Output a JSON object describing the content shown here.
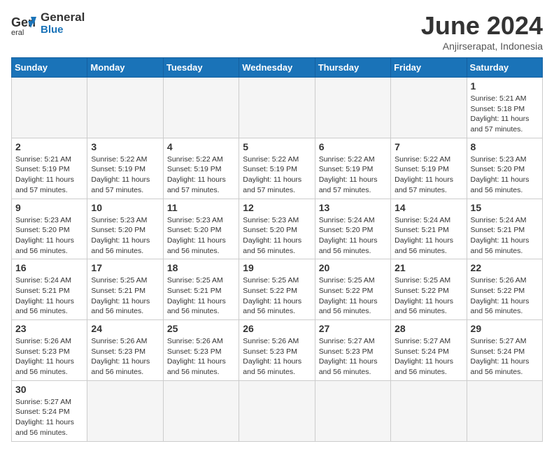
{
  "header": {
    "logo_line1": "General",
    "logo_line2": "Blue",
    "month_year": "June 2024",
    "location": "Anjirserapat, Indonesia"
  },
  "weekdays": [
    "Sunday",
    "Monday",
    "Tuesday",
    "Wednesday",
    "Thursday",
    "Friday",
    "Saturday"
  ],
  "weeks": [
    [
      {
        "day": null
      },
      {
        "day": null
      },
      {
        "day": null
      },
      {
        "day": null
      },
      {
        "day": null
      },
      {
        "day": null
      },
      {
        "day": "1",
        "sunrise": "5:21 AM",
        "sunset": "5:18 PM",
        "daylight": "11 hours and 57 minutes."
      }
    ],
    [
      {
        "day": "2",
        "sunrise": "5:21 AM",
        "sunset": "5:19 PM",
        "daylight": "11 hours and 57 minutes."
      },
      {
        "day": "3",
        "sunrise": "5:22 AM",
        "sunset": "5:19 PM",
        "daylight": "11 hours and 57 minutes."
      },
      {
        "day": "4",
        "sunrise": "5:22 AM",
        "sunset": "5:19 PM",
        "daylight": "11 hours and 57 minutes."
      },
      {
        "day": "5",
        "sunrise": "5:22 AM",
        "sunset": "5:19 PM",
        "daylight": "11 hours and 57 minutes."
      },
      {
        "day": "6",
        "sunrise": "5:22 AM",
        "sunset": "5:19 PM",
        "daylight": "11 hours and 57 minutes."
      },
      {
        "day": "7",
        "sunrise": "5:22 AM",
        "sunset": "5:19 PM",
        "daylight": "11 hours and 57 minutes."
      },
      {
        "day": "8",
        "sunrise": "5:23 AM",
        "sunset": "5:20 PM",
        "daylight": "11 hours and 56 minutes."
      }
    ],
    [
      {
        "day": "9",
        "sunrise": "5:23 AM",
        "sunset": "5:20 PM",
        "daylight": "11 hours and 56 minutes."
      },
      {
        "day": "10",
        "sunrise": "5:23 AM",
        "sunset": "5:20 PM",
        "daylight": "11 hours and 56 minutes."
      },
      {
        "day": "11",
        "sunrise": "5:23 AM",
        "sunset": "5:20 PM",
        "daylight": "11 hours and 56 minutes."
      },
      {
        "day": "12",
        "sunrise": "5:23 AM",
        "sunset": "5:20 PM",
        "daylight": "11 hours and 56 minutes."
      },
      {
        "day": "13",
        "sunrise": "5:24 AM",
        "sunset": "5:20 PM",
        "daylight": "11 hours and 56 minutes."
      },
      {
        "day": "14",
        "sunrise": "5:24 AM",
        "sunset": "5:21 PM",
        "daylight": "11 hours and 56 minutes."
      },
      {
        "day": "15",
        "sunrise": "5:24 AM",
        "sunset": "5:21 PM",
        "daylight": "11 hours and 56 minutes."
      }
    ],
    [
      {
        "day": "16",
        "sunrise": "5:24 AM",
        "sunset": "5:21 PM",
        "daylight": "11 hours and 56 minutes."
      },
      {
        "day": "17",
        "sunrise": "5:25 AM",
        "sunset": "5:21 PM",
        "daylight": "11 hours and 56 minutes."
      },
      {
        "day": "18",
        "sunrise": "5:25 AM",
        "sunset": "5:21 PM",
        "daylight": "11 hours and 56 minutes."
      },
      {
        "day": "19",
        "sunrise": "5:25 AM",
        "sunset": "5:22 PM",
        "daylight": "11 hours and 56 minutes."
      },
      {
        "day": "20",
        "sunrise": "5:25 AM",
        "sunset": "5:22 PM",
        "daylight": "11 hours and 56 minutes."
      },
      {
        "day": "21",
        "sunrise": "5:25 AM",
        "sunset": "5:22 PM",
        "daylight": "11 hours and 56 minutes."
      },
      {
        "day": "22",
        "sunrise": "5:26 AM",
        "sunset": "5:22 PM",
        "daylight": "11 hours and 56 minutes."
      }
    ],
    [
      {
        "day": "23",
        "sunrise": "5:26 AM",
        "sunset": "5:23 PM",
        "daylight": "11 hours and 56 minutes."
      },
      {
        "day": "24",
        "sunrise": "5:26 AM",
        "sunset": "5:23 PM",
        "daylight": "11 hours and 56 minutes."
      },
      {
        "day": "25",
        "sunrise": "5:26 AM",
        "sunset": "5:23 PM",
        "daylight": "11 hours and 56 minutes."
      },
      {
        "day": "26",
        "sunrise": "5:26 AM",
        "sunset": "5:23 PM",
        "daylight": "11 hours and 56 minutes."
      },
      {
        "day": "27",
        "sunrise": "5:27 AM",
        "sunset": "5:23 PM",
        "daylight": "11 hours and 56 minutes."
      },
      {
        "day": "28",
        "sunrise": "5:27 AM",
        "sunset": "5:24 PM",
        "daylight": "11 hours and 56 minutes."
      },
      {
        "day": "29",
        "sunrise": "5:27 AM",
        "sunset": "5:24 PM",
        "daylight": "11 hours and 56 minutes."
      }
    ],
    [
      {
        "day": "30",
        "sunrise": "5:27 AM",
        "sunset": "5:24 PM",
        "daylight": "11 hours and 56 minutes."
      },
      {
        "day": null
      },
      {
        "day": null
      },
      {
        "day": null
      },
      {
        "day": null
      },
      {
        "day": null
      },
      {
        "day": null
      }
    ]
  ],
  "labels": {
    "sunrise": "Sunrise:",
    "sunset": "Sunset:",
    "daylight": "Daylight:"
  }
}
